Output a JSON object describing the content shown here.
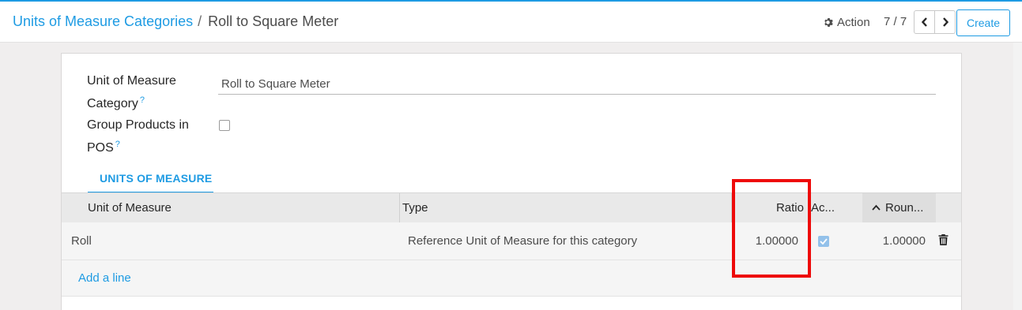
{
  "breadcrumb": {
    "parent": "Units of Measure Categories",
    "separator": "/",
    "current": "Roll to Square Meter"
  },
  "toolbar": {
    "action_label": "Action",
    "pager_value": "7 / 7",
    "create_label": "Create"
  },
  "form": {
    "category_label": "Unit of Measure Category",
    "category_help": "?",
    "category_value": "Roll to Square Meter",
    "group_pos_label": "Group Products in POS",
    "group_pos_help": "?",
    "group_pos_checked": false
  },
  "tab": {
    "label": "UNITS OF MEASURE"
  },
  "table": {
    "columns": [
      "Unit of Measure",
      "Type",
      "Ratio",
      "Ac...",
      "Roun..."
    ],
    "rows": [
      {
        "uom": "Roll",
        "type": "Reference Unit of Measure for this category",
        "ratio": "1.00000",
        "active": true,
        "rounding": "1.00000"
      }
    ],
    "add_line_label": "Add a line"
  },
  "colors": {
    "accent": "#1e9be3",
    "highlight": "#ee0a0a"
  },
  "icons": [
    "gear-icon",
    "chevron-left-icon",
    "chevron-right-icon",
    "sort-ascending-icon",
    "checkmark-icon",
    "trash-icon"
  ]
}
